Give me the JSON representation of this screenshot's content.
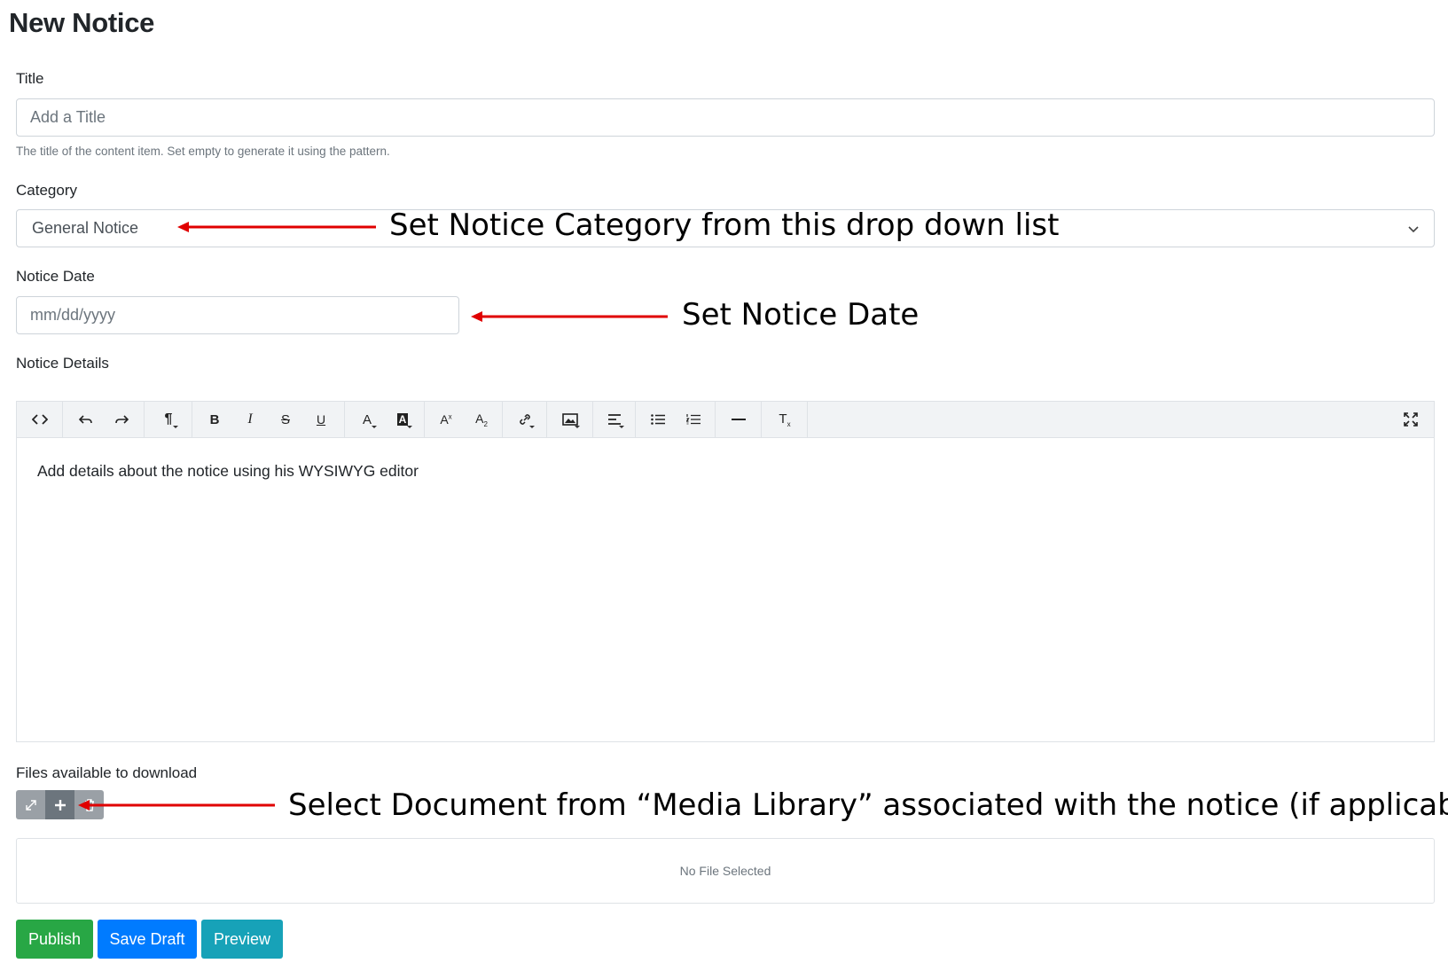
{
  "page": {
    "title": "New Notice"
  },
  "form": {
    "title": {
      "label": "Title",
      "placeholder": "Add a Title",
      "help": "The title of the content item. Set empty to generate it using the pattern."
    },
    "category": {
      "label": "Category",
      "selected": "General Notice"
    },
    "notice_date": {
      "label": "Notice Date",
      "placeholder": "mm/dd/yyyy"
    },
    "notice_details": {
      "label": "Notice Details",
      "body": "Add details about the notice using his WYSIWYG editor",
      "toolbar_icons": [
        "code-view-icon",
        "undo-icon",
        "redo-icon",
        "paragraph-style-icon",
        "bold-icon",
        "italic-icon",
        "strikethrough-icon",
        "underline-icon",
        "font-color-icon",
        "background-color-icon",
        "superscript-icon",
        "subscript-icon",
        "link-icon",
        "image-icon",
        "align-icon",
        "unordered-list-icon",
        "ordered-list-icon",
        "horizontal-rule-icon",
        "clear-formatting-icon",
        "fullscreen-icon"
      ]
    },
    "files": {
      "label": "Files available to download",
      "empty": "No File Selected"
    }
  },
  "actions": {
    "publish": "Publish",
    "save_draft": "Save Draft",
    "preview": "Preview"
  },
  "annotations": {
    "category": "Set Notice Category from this drop down list",
    "date": "Set Notice Date",
    "media": "Select Document from “Media Library” associated with the notice (if applicable)"
  },
  "colors": {
    "arrow": "#e00000",
    "publish": "#28a745",
    "save_draft": "#007bff",
    "preview": "#17a2b8",
    "toolbar_bg": "#f1f3f5"
  }
}
